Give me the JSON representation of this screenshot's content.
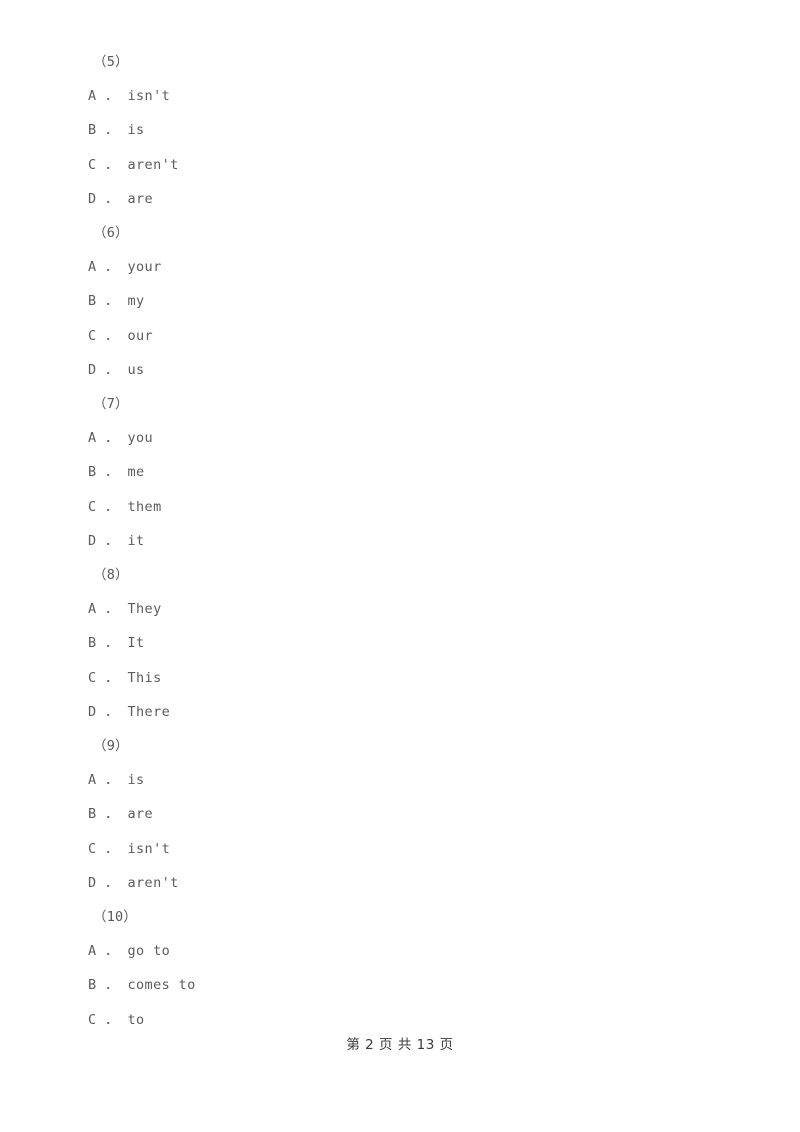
{
  "document": {
    "page_background": "#ffffff",
    "body_text_color": "#5c5c5c",
    "footer_text_color": "#3a3a3a"
  },
  "blocks": [
    {
      "number_label": "（5）",
      "options": [
        "A ． isn't",
        "B ． is",
        "C ． aren't",
        "D ． are"
      ]
    },
    {
      "number_label": "（6）",
      "options": [
        "A ． your",
        "B ． my",
        "C ． our",
        "D ． us"
      ]
    },
    {
      "number_label": "（7）",
      "options": [
        "A ． you",
        "B ． me",
        "C ． them",
        "D ． it"
      ]
    },
    {
      "number_label": "（8）",
      "options": [
        "A ． They",
        "B ． It",
        "C ． This",
        "D ． There"
      ]
    },
    {
      "number_label": "（9）",
      "options": [
        "A ． is",
        "B ． are",
        "C ． isn't",
        "D ． aren't"
      ]
    },
    {
      "number_label": "（10）",
      "options": [
        "A ． go to",
        "B ． comes to",
        "C ． to"
      ]
    }
  ],
  "footer": {
    "page_text": "第 2 页 共 13 页",
    "current_page": "2",
    "total_pages": "13"
  }
}
